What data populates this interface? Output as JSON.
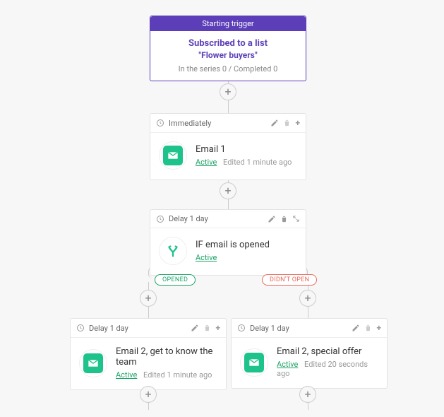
{
  "colors": {
    "accent": "#5c3fb8",
    "emailIcon": "#1ec28b",
    "splitIcon": "#1ec28b",
    "opened": "#1ba367",
    "didnt": "#e86a5b"
  },
  "trigger": {
    "header": "Starting trigger",
    "line1": "Subscribed to a list",
    "line2": "\"Flower buyers\"",
    "stats": "In the series 0 / Completed 0"
  },
  "step1": {
    "timing": "Immediately",
    "title": "Email 1",
    "status": "Active",
    "edited": "Edited 1 minute ago"
  },
  "step2": {
    "timing": "Delay 1 day",
    "title": "IF email is opened",
    "status": "Active"
  },
  "branchLabels": {
    "yes": "OPENED",
    "no": "DIDN'T OPEN"
  },
  "stepLeft": {
    "timing": "Delay 1 day",
    "title": "Email 2, get to know the team",
    "status": "Active",
    "edited": "Edited 1 minute ago"
  },
  "stepRight": {
    "timing": "Delay 1 day",
    "title": "Email 2, special offer",
    "status": "Active",
    "edited": "Edited 20 seconds ago"
  },
  "icons": {
    "clock": "clock-icon",
    "pencil": "pencil-icon",
    "trash": "trash-icon",
    "plus": "plus-icon",
    "expand": "expand-icon",
    "email": "email-icon",
    "split": "split-icon"
  }
}
